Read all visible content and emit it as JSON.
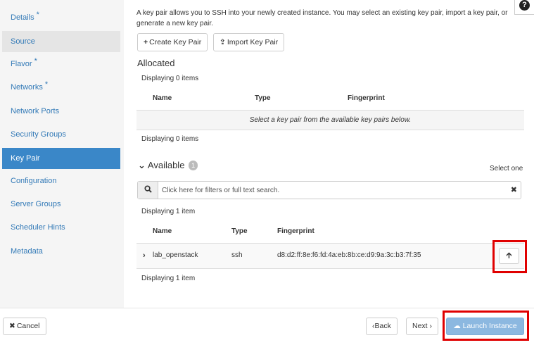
{
  "sidebar": {
    "items": [
      {
        "label": "Details",
        "required": "*"
      },
      {
        "label": "Source",
        "required": ""
      },
      {
        "label": "Flavor",
        "required": "*"
      },
      {
        "label": "Networks",
        "required": "*"
      },
      {
        "label": "Network Ports",
        "required": ""
      },
      {
        "label": "Security Groups",
        "required": ""
      },
      {
        "label": "Key Pair",
        "required": ""
      },
      {
        "label": "Configuration",
        "required": ""
      },
      {
        "label": "Server Groups",
        "required": ""
      },
      {
        "label": "Scheduler Hints",
        "required": ""
      },
      {
        "label": "Metadata",
        "required": ""
      }
    ]
  },
  "help_icon": "question-circle-icon",
  "description": "A key pair allows you to SSH into your newly created instance. You may select an existing key pair, import a key pair, or generate a new key pair.",
  "buttons": {
    "create": {
      "icon": "+",
      "label": "Create Key Pair"
    },
    "import": {
      "icon": "⇪",
      "label": "Import Key Pair"
    }
  },
  "allocated": {
    "title": "Allocated",
    "count_top": "Displaying 0 items",
    "count_bottom": "Displaying 0 items",
    "columns": [
      "Name",
      "Type",
      "Fingerprint"
    ],
    "empty_message": "Select a key pair from the available key pairs below."
  },
  "available": {
    "title": "Available",
    "badge": "1",
    "select_hint": "Select one",
    "search_placeholder": "Click here for filters or full text search.",
    "search_icon": "search-icon",
    "clear_icon": "✖",
    "count_top": "Displaying 1 item",
    "count_bottom": "Displaying 1 item",
    "columns": [
      "Name",
      "Type",
      "Fingerprint"
    ],
    "rows": [
      {
        "name": "lab_openstack",
        "type": "ssh",
        "fingerprint": "d8:d2:ff:8e:f6:fd:4a:eb:8b:ce:d9:9a:3c:b3:7f:35"
      }
    ]
  },
  "footer": {
    "cancel": "Cancel",
    "back": "Back",
    "next": "Next",
    "launch": "Launch Instance"
  },
  "colors": {
    "active_nav": "#3a87c8",
    "link": "#337ab7",
    "launch_disabled": "#8cb8e0",
    "highlight": "#e00000"
  }
}
